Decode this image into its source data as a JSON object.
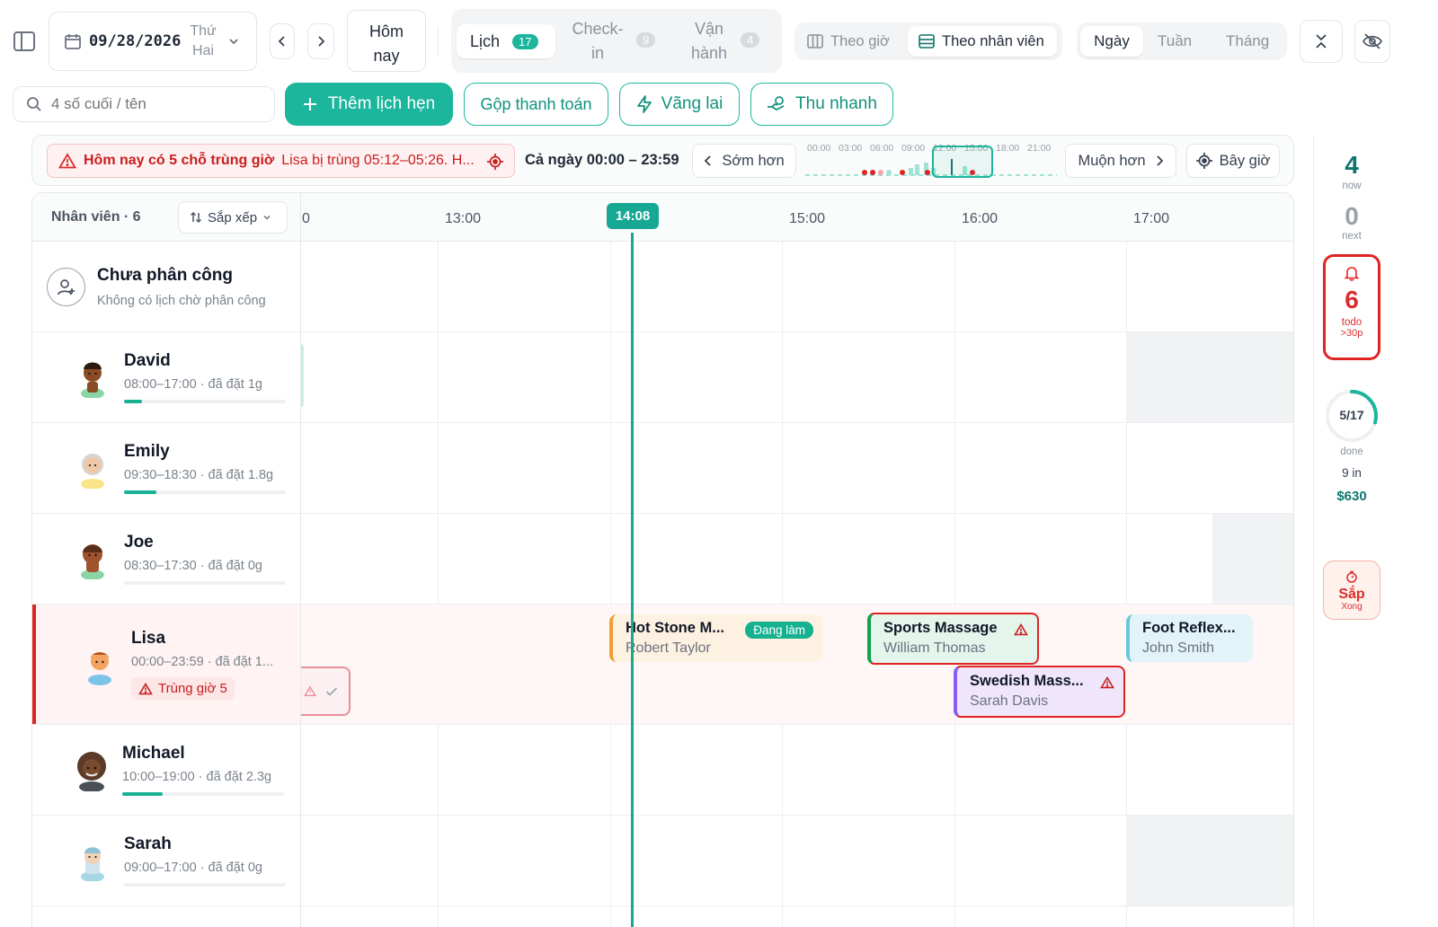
{
  "topbar": {
    "date": "09/28/2026",
    "weekday_line1": "Thứ",
    "weekday_line2": "Hai",
    "today_line1": "Hôm",
    "today_line2": "nay",
    "tabs": [
      {
        "label": "Lịch",
        "count": "17"
      },
      {
        "label_line1": "Check-",
        "label_line2": "in",
        "count": "9"
      },
      {
        "label_line1": "Vận",
        "label_line2": "hành",
        "count": "4"
      }
    ],
    "view_by_time": "Theo giờ",
    "view_by_staff": "Theo nhân viên",
    "range_day": "Ngày",
    "range_week": "Tuần",
    "range_month": "Tháng"
  },
  "toolbar": {
    "search_placeholder": "4 số cuối / tên",
    "add_appointment": "Thêm lịch hẹn",
    "merge_payment": "Gộp thanh toán",
    "walk_in": "Vãng lai",
    "quick_collect": "Thu nhanh"
  },
  "alert_bar": {
    "alert_title": "Hôm nay có 5 chỗ trùng giờ",
    "alert_detail": "Lisa bị trùng 05:12–05:26. H...",
    "range_label": "Cả ngày 00:00 – 23:59",
    "earlier": "Sớm hơn",
    "later": "Muộn hơn",
    "now": "Bây giờ",
    "mini_ticks": [
      "00:00",
      "03:00",
      "06:00",
      "09:00",
      "12:00",
      "15:00",
      "18:00",
      "21:00"
    ]
  },
  "schedule": {
    "staff_header": "Nhân viên · 6",
    "sort_label": "Sắp xếp",
    "time_cut_label": "0",
    "hours": [
      "13:00",
      "15:00",
      "16:00",
      "17:00"
    ],
    "now_time": "14:08",
    "unassigned": {
      "title": "Chưa phân công",
      "subtitle": "Không có lịch chờ phân công"
    },
    "staff": [
      {
        "name": "David",
        "detail": "08:00–17:00 · đã đặt 1g",
        "progress": 0.11
      },
      {
        "name": "Emily",
        "detail": "09:30–18:30 · đã đặt 1.8g",
        "progress": 0.2
      },
      {
        "name": "Joe",
        "detail": "08:30–17:30 · đã đặt 0g",
        "progress": 0
      },
      {
        "name": "Lisa",
        "detail": "00:00–23:59 · đã đặt 1...",
        "badge": "Trùng giờ 5"
      },
      {
        "name": "Michael",
        "detail": "10:00–19:00 · đã đặt 2.3g",
        "progress": 0.25
      },
      {
        "name": "Sarah",
        "detail": "09:00–17:00 · đã đặt 0g",
        "progress": 0
      }
    ],
    "appointments": [
      {
        "service": "Hot Stone M...",
        "client": "Robert Taylor",
        "status": "Đang làm"
      },
      {
        "service": "Sports Massage",
        "client": "William Thomas"
      },
      {
        "service": "Swedish Mass...",
        "client": "Sarah Davis"
      },
      {
        "service": "Foot Reflex...",
        "client": "John Smith"
      }
    ]
  },
  "rail": {
    "now_count": "4",
    "now_label": "now",
    "next_count": "0",
    "next_label": "next",
    "todo_count": "6",
    "todo_label": "todo",
    "todo_sub": ">30p",
    "progress_text": "5/17",
    "progress_fraction": 0.294,
    "progress_label": "done",
    "checked_in": "9 in",
    "revenue": "$630",
    "closing_label": "Sắp",
    "closing_sub": "Xong"
  },
  "colors": {
    "accent": "#1cb69c",
    "danger": "#d92d2d",
    "danger_bg": "#fff0f0"
  }
}
